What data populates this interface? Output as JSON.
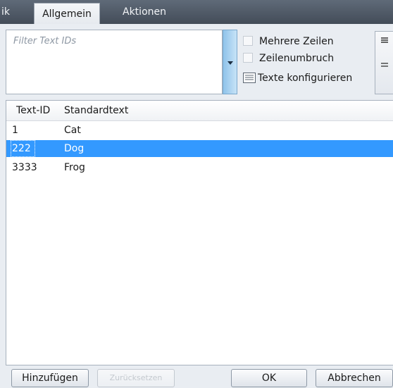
{
  "tabs": {
    "partial_label": "ik",
    "active_label": "Allgemein",
    "actions_label": "Aktionen"
  },
  "filter": {
    "placeholder": "Filter Text IDs",
    "value": ""
  },
  "options": {
    "multiline_label": "Mehrere Zeilen",
    "wrap_label": "Zeilenumbruch",
    "configure_label": "Texte konfigurieren"
  },
  "grid": {
    "columns": [
      "Text-ID",
      "Standardtext"
    ],
    "rows": [
      {
        "id": "1",
        "text": "Cat",
        "selected": false
      },
      {
        "id": "222",
        "text": "Dog",
        "selected": true
      },
      {
        "id": "3333",
        "text": "Frog",
        "selected": false
      }
    ]
  },
  "buttons": {
    "add": "Hinzufügen",
    "reset": "Zurücksetzen",
    "ok": "OK",
    "cancel": "Abbrechen"
  },
  "colors": {
    "selection": "#3399ff",
    "tabstrip": "#4e5865",
    "dropdown": "#a9d3f2"
  }
}
